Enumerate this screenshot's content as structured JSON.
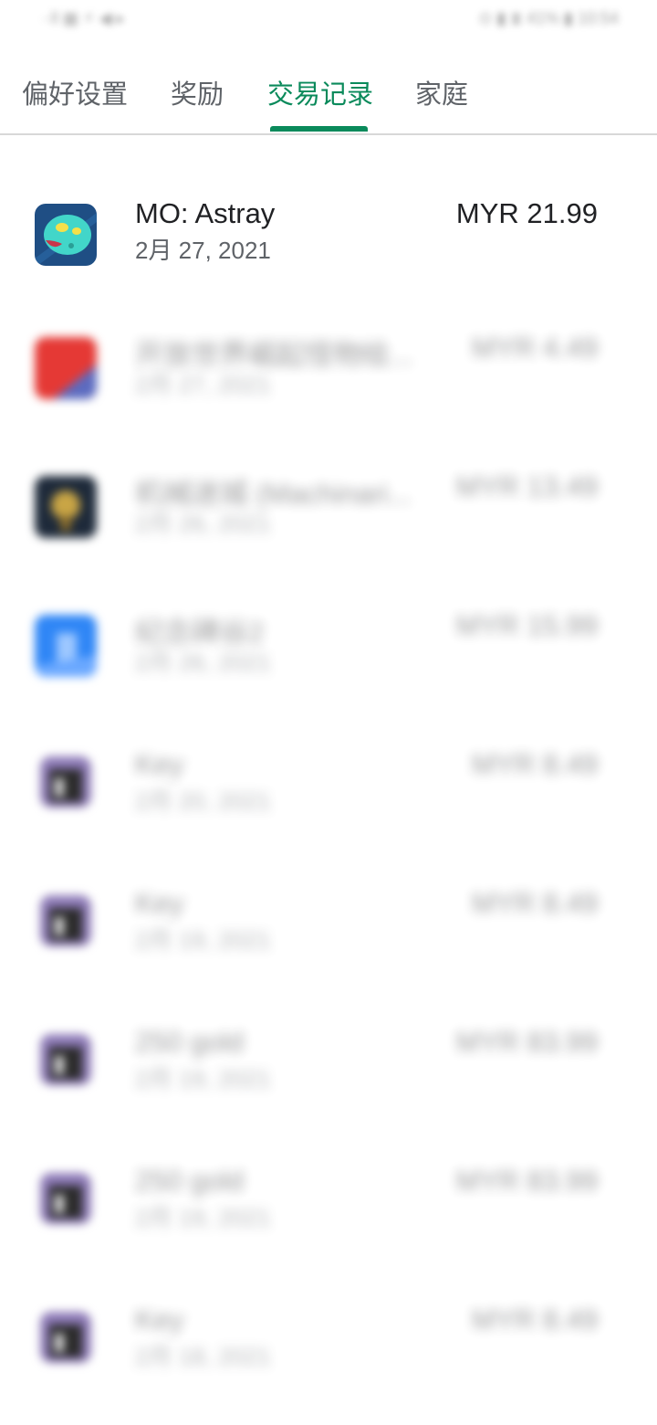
{
  "status_bar": {
    "left_text": "∙∙ll ▦ ⚡ ◀ ▸",
    "right_text": "⊙ ▮ ⧗ 41% ▮ 10:54"
  },
  "tabs": [
    {
      "label": "偏好设置",
      "active": false
    },
    {
      "label": "奖励",
      "active": false
    },
    {
      "label": "交易记录",
      "active": true
    },
    {
      "label": "家庭",
      "active": false
    }
  ],
  "accent_color": "#0a8a5b",
  "transactions": [
    {
      "title": "MO: Astray",
      "date": "2月 27, 2021",
      "price": "MYR 21.99",
      "icon": "mo-astray-icon"
    },
    {
      "title": "开放世界崛起怪物绘...",
      "date": "2月 27, 2021",
      "price": "MYR 4.49",
      "icon": "red-game-icon"
    },
    {
      "title": "机械迷城 (Machinari...",
      "date": "2月 26, 2021",
      "price": "MYR 13.49",
      "icon": "machinarium-icon"
    },
    {
      "title": "纪念碑谷2",
      "date": "2月 26, 2021",
      "price": "MYR 15.99",
      "icon": "blue-game-icon"
    },
    {
      "title": "Key",
      "date": "2月 20, 2021",
      "price": "MYR 8.49",
      "icon": "purple-game-icon"
    },
    {
      "title": "Key",
      "date": "2月 19, 2021",
      "price": "MYR 8.49",
      "icon": "purple-game-icon"
    },
    {
      "title": "250 gold",
      "date": "2月 19, 2021",
      "price": "MYR 83.99",
      "icon": "purple-game-icon"
    },
    {
      "title": "250 gold",
      "date": "2月 19, 2021",
      "price": "MYR 83.99",
      "icon": "purple-game-icon"
    },
    {
      "title": "Key",
      "date": "2月 18, 2021",
      "price": "MYR 8.49",
      "icon": "purple-game-icon"
    }
  ]
}
